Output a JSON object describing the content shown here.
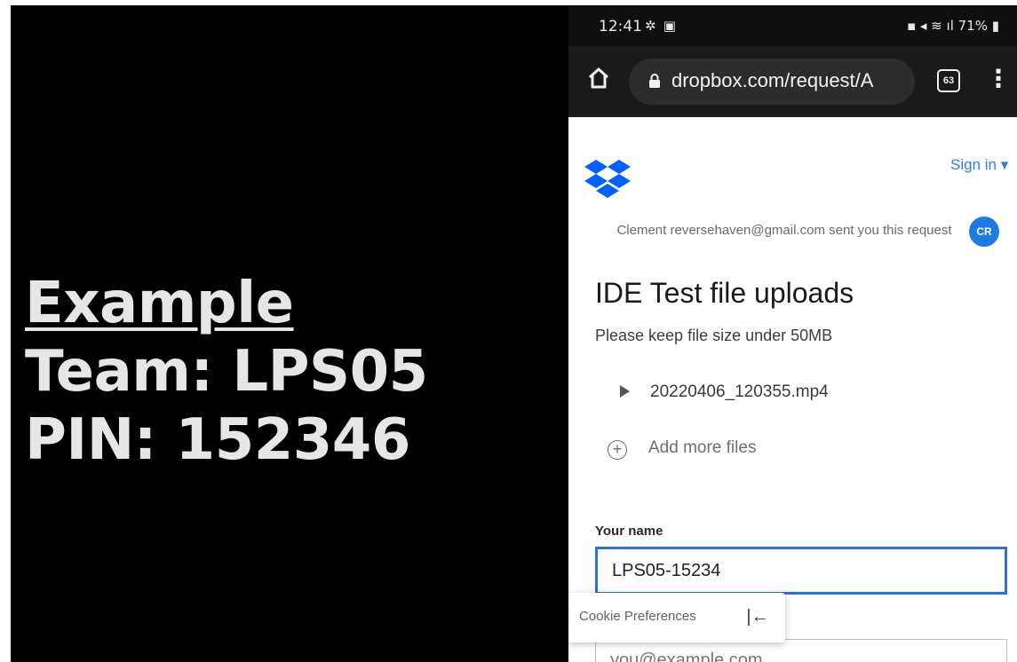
{
  "overlay": {
    "line1": "Example",
    "line2": "Team: LPS05",
    "line3": "PIN: 152346"
  },
  "status_bar": {
    "time": "12:41",
    "left_icons": "✲ ▣",
    "battery": "71%"
  },
  "browser": {
    "url": "dropbox.com/request/A",
    "tab_count": "63"
  },
  "header": {
    "signin_label": "Sign in ▾"
  },
  "request": {
    "sender_text": "Clement reversehaven@gmail.com sent you this request",
    "avatar_initials": "CR",
    "title": "IDE Test file uploads",
    "description": "Please keep file size under 50MB",
    "files": [
      {
        "name": "20220406_120355.mp4"
      }
    ],
    "add_more_label": "Add more files"
  },
  "form": {
    "name_label": "Your name",
    "name_value": "LPS05-15234",
    "email_placeholder": "you@example.com"
  },
  "cookie": {
    "label": "Cookie Preferences"
  },
  "colors": {
    "accent": "#2f6fd6",
    "dropbox_blue": "#0061fe",
    "link": "#2f7fe0"
  }
}
